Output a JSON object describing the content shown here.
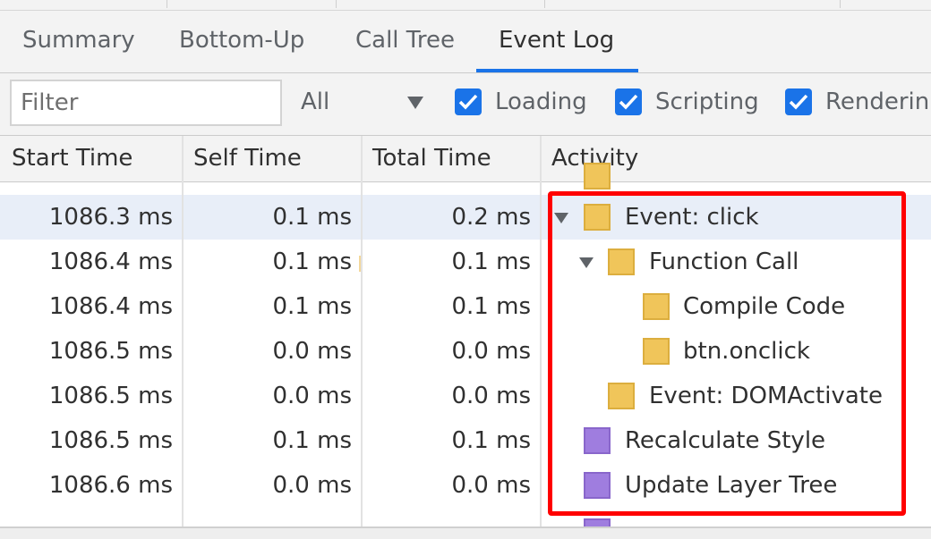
{
  "tabs": [
    {
      "label": "Summary"
    },
    {
      "label": "Bottom-Up"
    },
    {
      "label": "Call Tree"
    },
    {
      "label": "Event Log"
    }
  ],
  "active_tab": "Event Log",
  "toolbar": {
    "filter_placeholder": "Filter",
    "filter_value": "",
    "duration_select": "All",
    "checkboxes": [
      {
        "label": "Loading",
        "checked": true
      },
      {
        "label": "Scripting",
        "checked": true
      },
      {
        "label": "Renderin",
        "checked": true
      }
    ]
  },
  "columns": {
    "start": "Start Time",
    "self": "Self Time",
    "total": "Total Time",
    "activity": "Activity"
  },
  "rows": [
    {
      "start": "1086.3 ms",
      "self": "0.1 ms",
      "total": "0.2 ms",
      "activity": "Event: click",
      "expanded": true,
      "color": "#f0c55a"
    },
    {
      "start": "1086.4 ms",
      "self": "0.1 ms",
      "total": "0.1 ms",
      "activity": "Function Call",
      "expanded": true,
      "color": "#f0c55a"
    },
    {
      "start": "1086.4 ms",
      "self": "0.1 ms",
      "total": "0.1 ms",
      "activity": "Compile Code",
      "color": "#f0c55a"
    },
    {
      "start": "1086.5 ms",
      "self": "0.0 ms",
      "total": "0.0 ms",
      "activity": "btn.onclick",
      "color": "#f0c55a"
    },
    {
      "start": "1086.5 ms",
      "self": "0.0 ms",
      "total": "0.0 ms",
      "activity": "Event: DOMActivate",
      "color": "#f0c55a"
    },
    {
      "start": "1086.5 ms",
      "self": "0.1 ms",
      "total": "0.1 ms",
      "activity": "Recalculate Style",
      "color": "#9f7ddf"
    },
    {
      "start": "1086.6 ms",
      "self": "0.0 ms",
      "total": "0.0 ms",
      "activity": "Update Layer Tree",
      "color": "#9f7ddf"
    }
  ],
  "colors": {
    "accent": "#1a73e8",
    "scripting": "#f0c55a",
    "rendering": "#9f7ddf",
    "highlight_box": "#ff0000",
    "selected_row": "#e8eef8"
  }
}
